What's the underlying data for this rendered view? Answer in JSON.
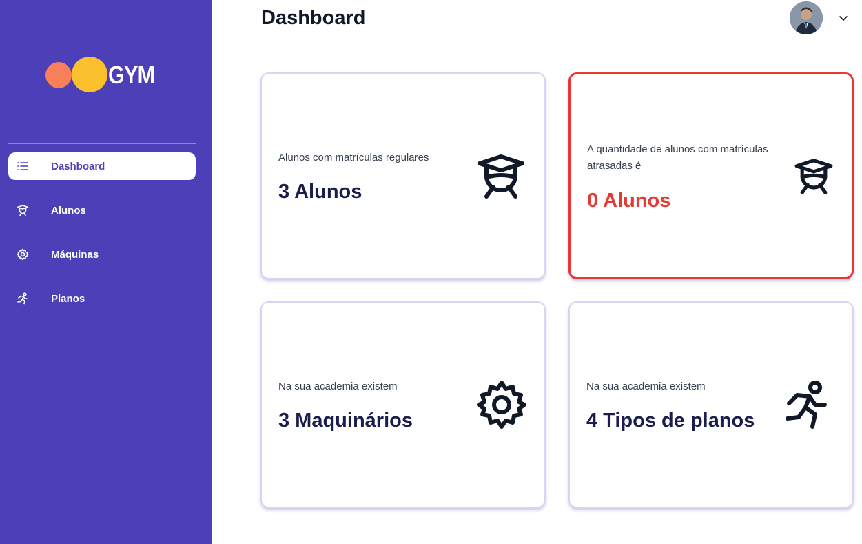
{
  "logo": {
    "text": "GYM"
  },
  "sidebar": {
    "items": [
      {
        "label": "Dashboard",
        "icon": "list-icon",
        "active": true
      },
      {
        "label": "Alunos",
        "icon": "graduate-icon",
        "active": false
      },
      {
        "label": "Máquinas",
        "icon": "gear-icon",
        "active": false
      },
      {
        "label": "Planos",
        "icon": "running-icon",
        "active": false
      }
    ]
  },
  "header": {
    "title": "Dashboard"
  },
  "cards": [
    {
      "desc": "Alunos com matrículas regulares",
      "value": "3 Alunos",
      "icon": "graduate-icon"
    },
    {
      "desc": "A quantidade de alunos com matrículas atrasadas é",
      "value": "0 Alunos",
      "icon": "graduate-icon"
    },
    {
      "desc": "Na sua academia existem",
      "value": "3 Maquinários",
      "icon": "gear-icon"
    },
    {
      "desc": "Na sua academia existem",
      "value": "4 Tipos de planos",
      "icon": "running-icon"
    }
  ],
  "colors": {
    "sidebar": "#4c3fb8",
    "alert": "#e53935",
    "logo_orange": "#f77f5a",
    "logo_yellow": "#fbc02d"
  }
}
